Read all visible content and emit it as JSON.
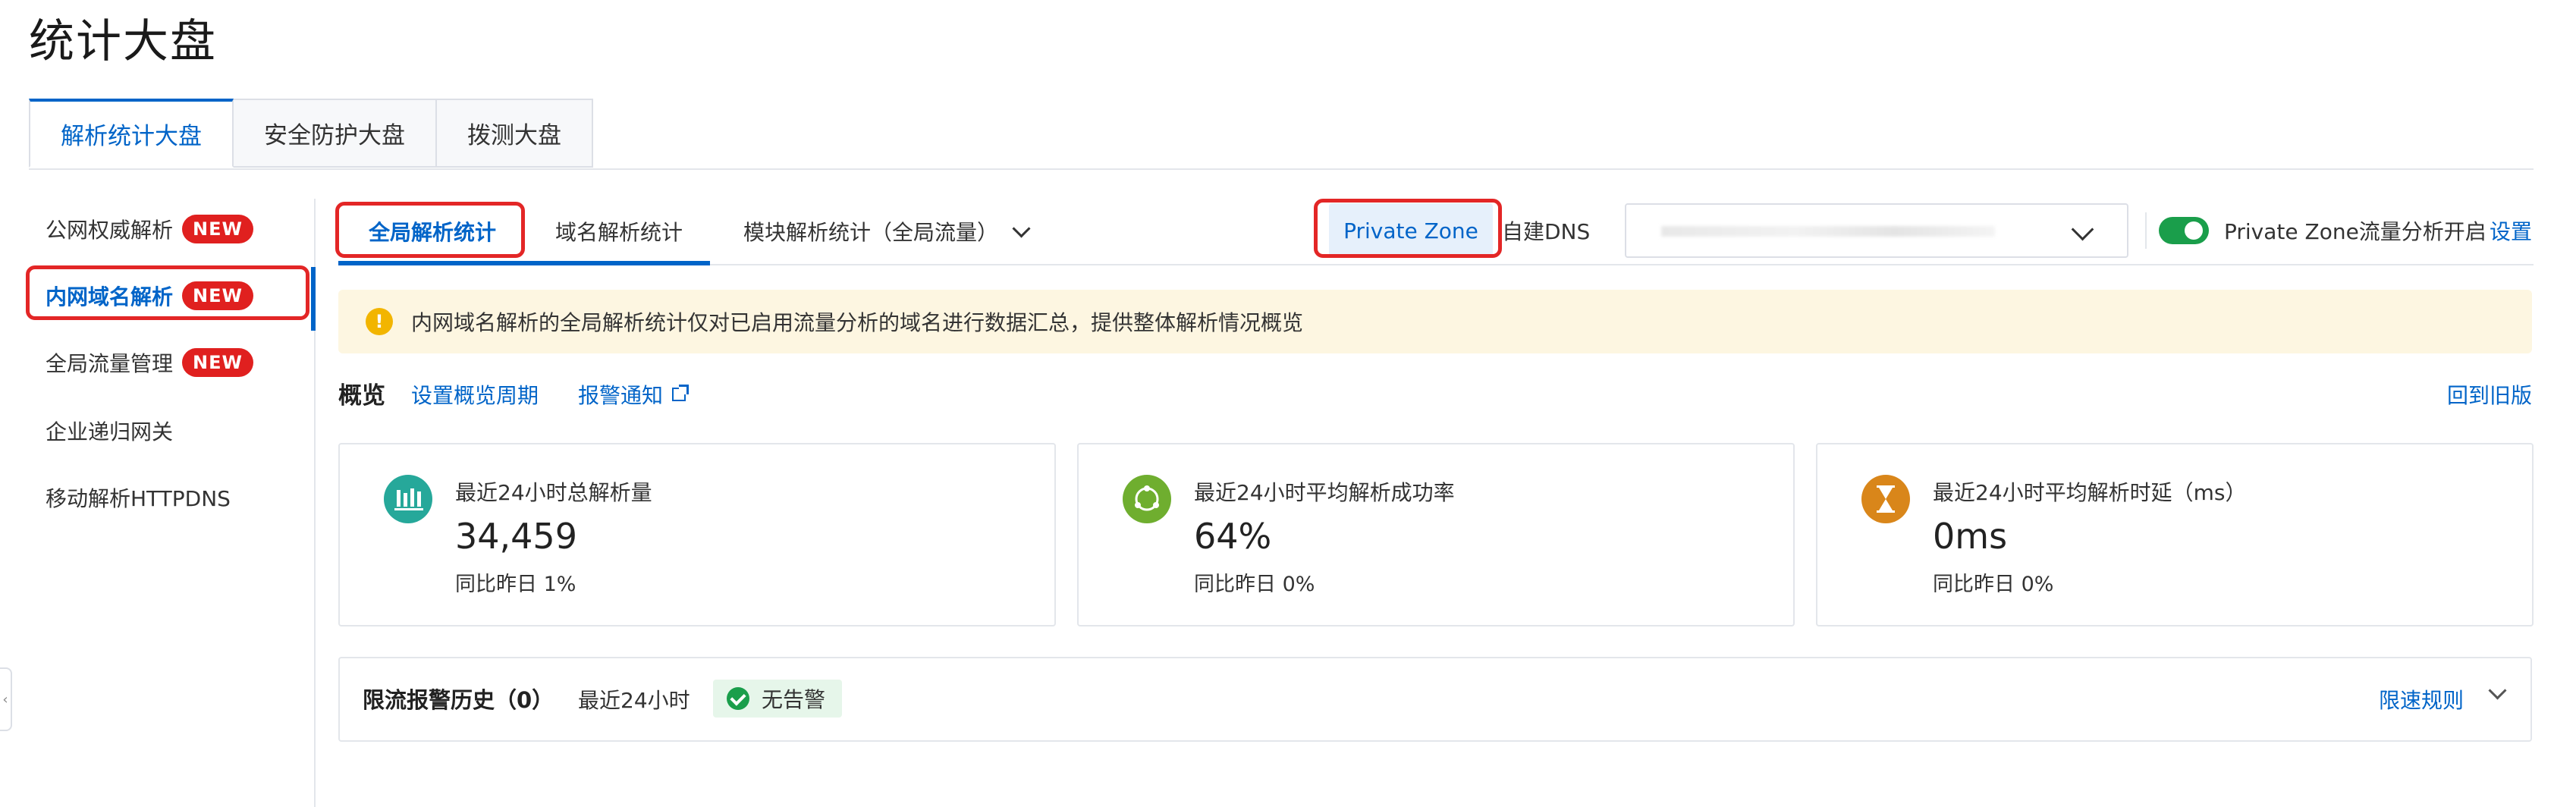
{
  "page": {
    "title": "统计大盘"
  },
  "top_tabs": [
    {
      "label": "解析统计大盘",
      "active": true
    },
    {
      "label": "安全防护大盘",
      "active": false
    },
    {
      "label": "拨测大盘",
      "active": false
    }
  ],
  "sidebar": {
    "items": [
      {
        "label": "公网权威解析",
        "badge": "NEW"
      },
      {
        "label": "内网域名解析",
        "badge": "NEW",
        "active": true
      },
      {
        "label": "全局流量管理",
        "badge": "NEW"
      },
      {
        "label": "企业递归网关"
      },
      {
        "label": "移动解析HTTPDNS"
      }
    ]
  },
  "sub_tabs": {
    "global": "全局解析统计",
    "domain": "域名解析统计",
    "module": "模块解析统计（全局流量）"
  },
  "zone_switch": {
    "private_zone": "Private Zone",
    "self_dns": "自建DNS"
  },
  "traffic_toggle": {
    "label": "Private Zone流量分析开启",
    "on": true,
    "settings_link": "设置",
    "on_color": "#1a9e4b"
  },
  "notice": {
    "icon": "warning-icon",
    "text": "内网域名解析的全局解析统计仅对已启用流量分析的域名进行数据汇总，提供整体解析情况概览"
  },
  "overview": {
    "title": "概览",
    "period_link": "设置概览周期",
    "alert_link": "报警通知",
    "back_link": "回到旧版"
  },
  "metrics": [
    {
      "icon": "bar-chart-icon",
      "color": "#26a89a",
      "label": "最近24小时总解析量",
      "value": "34,459",
      "compare": "同比昨日 1%"
    },
    {
      "icon": "success-cycle-icon",
      "color": "#6fae2f",
      "label": "最近24小时平均解析成功率",
      "value": "64%",
      "compare": "同比昨日 0%"
    },
    {
      "icon": "hourglass-icon",
      "color": "#d9861a",
      "label": "最近24小时平均解析时延（ms）",
      "value": "0ms",
      "compare": "同比昨日 0%"
    }
  ],
  "rate_limit": {
    "title": "限流报警历史（0）",
    "range": "最近24小时",
    "status": "无告警",
    "rule_link": "限速规则"
  },
  "colors": {
    "accent": "#0064c8",
    "highlight_box": "#e32626",
    "new_badge": "#e0201f"
  }
}
